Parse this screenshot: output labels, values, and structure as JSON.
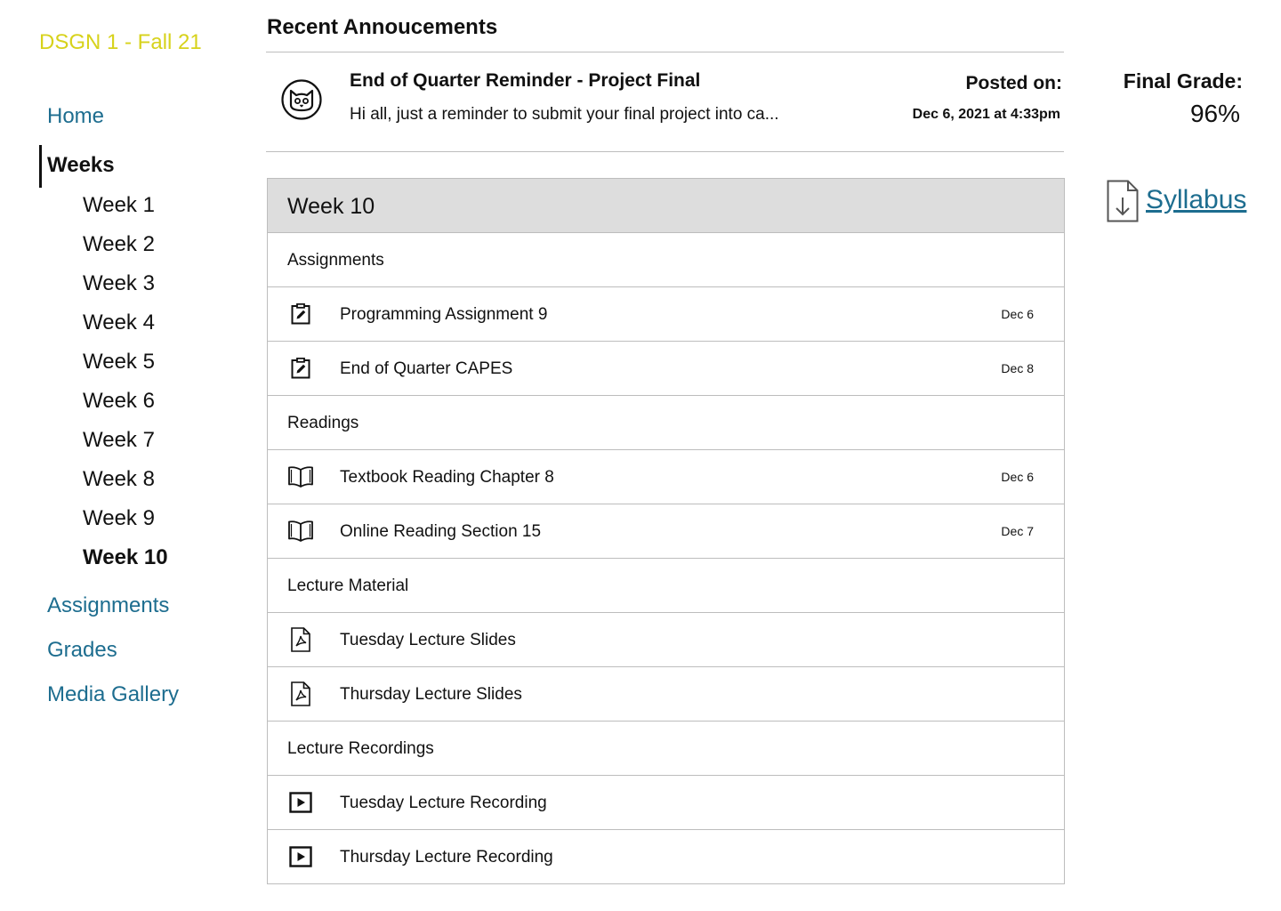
{
  "sidebar": {
    "course_title": "DSGN 1 - Fall 21",
    "home": "Home",
    "weeks_label": "Weeks",
    "weeks": [
      "Week 1",
      "Week 2",
      "Week 3",
      "Week 4",
      "Week 5",
      "Week 6",
      "Week 7",
      "Week 8",
      "Week 9",
      "Week 10"
    ],
    "active_week": "Week 10",
    "assignments": "Assignments",
    "grades": "Grades",
    "media_gallery": "Media Gallery"
  },
  "announcements": {
    "heading": "Recent Annoucements",
    "items": [
      {
        "avatar_icon": "cat-face-icon",
        "title": "End of Quarter Reminder - Project Final",
        "preview": "Hi all, just a reminder to submit your final project into ca...",
        "posted_label": "Posted on:",
        "posted_date": "Dec 6, 2021 at 4:33pm"
      }
    ]
  },
  "grade": {
    "label": "Final Grade:",
    "value": "96%"
  },
  "syllabus": {
    "label": "Syllabus",
    "icon": "document-download-icon"
  },
  "week_panel": {
    "title": "Week 10",
    "sections": [
      {
        "label": "Assignments",
        "items": [
          {
            "icon": "assignment-edit-icon",
            "label": "Programming Assignment 9",
            "date": "Dec 6"
          },
          {
            "icon": "assignment-edit-icon",
            "label": "End of Quarter CAPES",
            "date": "Dec 8"
          }
        ]
      },
      {
        "label": "Readings",
        "items": [
          {
            "icon": "open-book-icon",
            "label": "Textbook Reading Chapter 8",
            "date": "Dec 6"
          },
          {
            "icon": "open-book-icon",
            "label": "Online Reading Section 15",
            "date": "Dec 7"
          }
        ]
      },
      {
        "label": "Lecture Material",
        "items": [
          {
            "icon": "pdf-file-icon",
            "label": "Tuesday Lecture Slides",
            "date": ""
          },
          {
            "icon": "pdf-file-icon",
            "label": "Thursday Lecture Slides",
            "date": ""
          }
        ]
      },
      {
        "label": "Lecture Recordings",
        "items": [
          {
            "icon": "video-play-icon",
            "label": "Tuesday Lecture Recording",
            "date": ""
          },
          {
            "icon": "video-play-icon",
            "label": "Thursday Lecture Recording",
            "date": ""
          }
        ]
      }
    ]
  },
  "colors": {
    "course_title": "#d7d21b",
    "link": "#1d6d8f",
    "panel_header_bg": "#dddddd",
    "border": "#bdbdbd"
  }
}
